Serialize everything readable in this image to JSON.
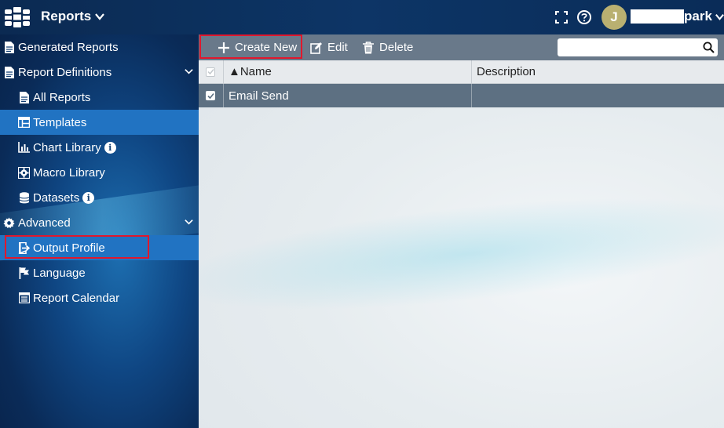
{
  "header": {
    "app_title": "Reports",
    "avatar_initial": "J",
    "username_suffix": "park",
    "icons": [
      "logo-icon",
      "chevron-down-icon",
      "fullscreen-icon",
      "help-icon",
      "avatar",
      "chevron-down-icon"
    ]
  },
  "sidebar": {
    "items": [
      {
        "label": "Generated Reports",
        "icon": "document-icon"
      },
      {
        "label": "Report Definitions",
        "icon": "document-icon"
      },
      {
        "label": "All Reports",
        "icon": "document-icon"
      },
      {
        "label": "Templates",
        "icon": "template-icon"
      },
      {
        "label": "Chart Library",
        "icon": "chart-icon"
      },
      {
        "label": "Macro Library",
        "icon": "gear-icon"
      },
      {
        "label": "Datasets",
        "icon": "database-icon"
      },
      {
        "label": "Advanced",
        "icon": "gear-icon"
      },
      {
        "label": "Output Profile",
        "icon": "output-profile-icon"
      },
      {
        "label": "Language",
        "icon": "flag-icon"
      },
      {
        "label": "Report Calendar",
        "icon": "calendar-icon"
      }
    ],
    "active_item": "Templates",
    "highlighted_item": "Output Profile"
  },
  "toolbar": {
    "create_new_label": "Create New",
    "edit_label": "Edit",
    "delete_label": "Delete",
    "search_placeholder": ""
  },
  "table": {
    "columns": [
      "▲Name",
      "Description"
    ],
    "rows": [
      {
        "name": "Email Send",
        "description": "",
        "checked": true
      }
    ]
  },
  "colors": {
    "accent_red": "#e0182d",
    "active_blue": "#2173c2",
    "toolbar_gray": "#69798a"
  }
}
